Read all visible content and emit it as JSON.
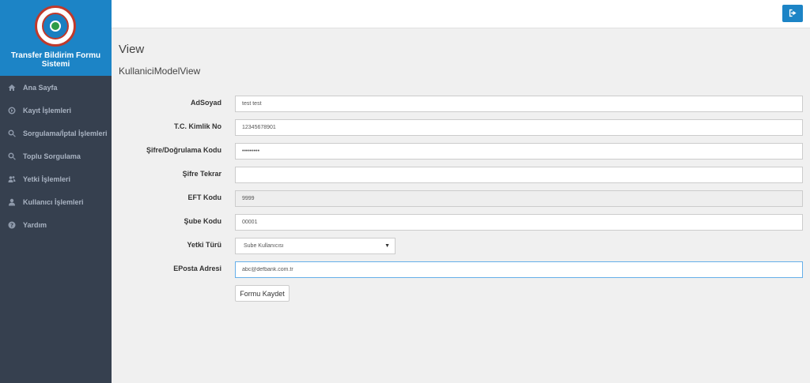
{
  "sidebar": {
    "brand_title": "Transfer Bildirim Formu Sistemi",
    "items": [
      {
        "label": "Ana Sayfa",
        "icon": "home-icon"
      },
      {
        "label": "Kayıt İşlemleri",
        "icon": "arrow-circle-icon"
      },
      {
        "label": "Sorgulama/İptal İşlemleri",
        "icon": "search-icon"
      },
      {
        "label": "Toplu Sorgulama",
        "icon": "search-icon"
      },
      {
        "label": "Yetki İşlemleri",
        "icon": "users-icon"
      },
      {
        "label": "Kullanıcı İşlemleri",
        "icon": "user-icon"
      },
      {
        "label": "Yardım",
        "icon": "question-icon"
      }
    ]
  },
  "header": {
    "logout_icon": "sign-out-icon",
    "accent": "#1c84c6"
  },
  "page": {
    "title": "View",
    "subtitle": "KullaniciModelView"
  },
  "form": {
    "adsoyad": {
      "label": "AdSoyad",
      "value": "test test"
    },
    "tckimlik": {
      "label": "T.C. Kimlik No",
      "value": "12345678901"
    },
    "sifre": {
      "label": "Şifre/Doğrulama Kodu",
      "value": "•••••••••"
    },
    "sifre_tekrar": {
      "label": "Şifre Tekrar",
      "value": ""
    },
    "eft": {
      "label": "EFT Kodu",
      "value": "9999"
    },
    "sube": {
      "label": "Şube Kodu",
      "value": "00001"
    },
    "yetki": {
      "label": "Yetki Türü",
      "value": "Sube Kullanıcısı"
    },
    "eposta": {
      "label": "EPosta Adresi",
      "value": "abc@defbank.com.tr"
    },
    "submit_label": "Formu Kaydet"
  }
}
